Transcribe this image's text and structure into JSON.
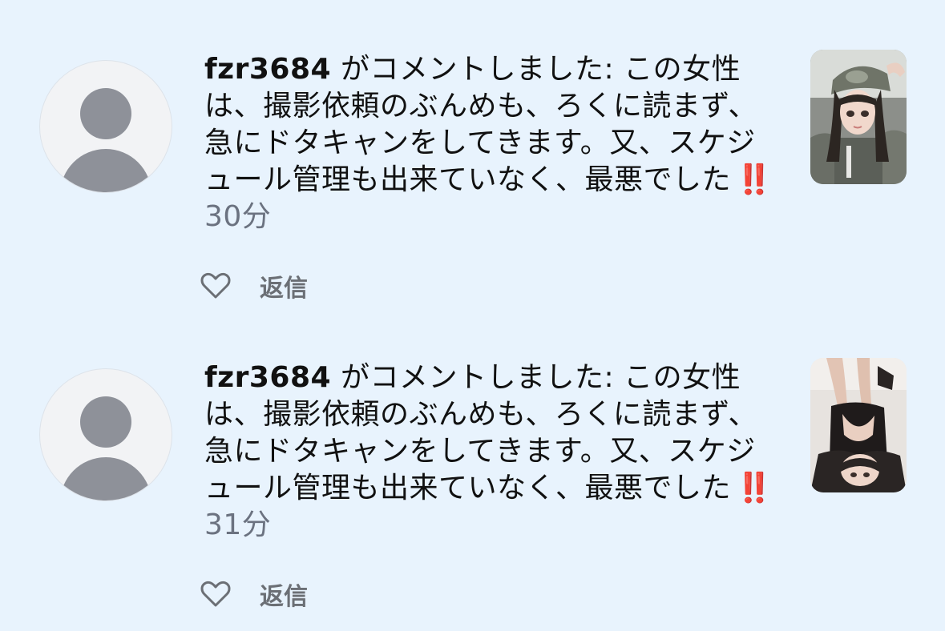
{
  "notifications": [
    {
      "username": "fzr3684",
      "message": "がコメントしました: この女性は、撮影依頼のぶんめも、ろくに読まず、急にドタキャンをしてきます。又、スケジュール管理も出来ていなく、最悪でした",
      "alert_emoji": "‼️",
      "time": "30分",
      "reply_label": "返信",
      "like_icon": "heart-outline-icon",
      "avatar_icon": "default-user-icon",
      "thumbnail": "photo-thumbnail"
    },
    {
      "username": "fzr3684",
      "message": "がコメントしました: この女性は、撮影依頼のぶんめも、ろくに読まず、急にドタキャンをしてきます。又、スケジュール管理も出来ていなく、最悪でした",
      "alert_emoji": "‼️",
      "time": "31分",
      "reply_label": "返信",
      "like_icon": "heart-outline-icon",
      "avatar_icon": "default-user-icon",
      "thumbnail": "photo-thumbnail"
    }
  ],
  "colors": {
    "background": "#e8f3fd",
    "text": "#111111",
    "muted": "#6b7280",
    "alert": "#d9282f",
    "avatar_fill": "#8e9199"
  }
}
